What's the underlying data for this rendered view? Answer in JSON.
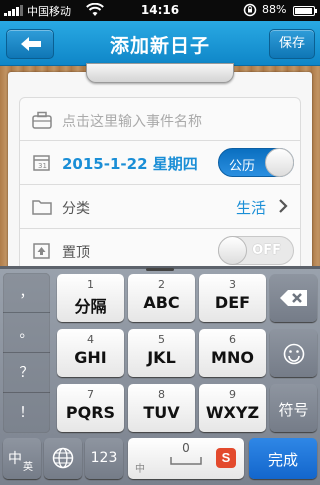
{
  "status_bar": {
    "carrier": "中国移动",
    "time": "14:16",
    "battery_pct": "88%"
  },
  "nav": {
    "title": "添加新日子",
    "save_label": "保存"
  },
  "form": {
    "event_placeholder": "点击这里输入事件名称",
    "date": "2015-1-22 星期四",
    "calendar_toggle": "公历",
    "category_label": "分类",
    "category_value": "生活",
    "pin_label": "置顶",
    "pin_toggle": "OFF"
  },
  "keyboard": {
    "side_keys": [
      "，",
      "。",
      "？",
      "！"
    ],
    "rows": [
      [
        {
          "num": "1",
          "label": "分隔"
        },
        {
          "num": "2",
          "label": "ABC"
        },
        {
          "num": "3",
          "label": "DEF"
        }
      ],
      [
        {
          "num": "4",
          "label": "GHI"
        },
        {
          "num": "5",
          "label": "JKL"
        },
        {
          "num": "6",
          "label": "MNO"
        }
      ],
      [
        {
          "num": "7",
          "label": "PQRS"
        },
        {
          "num": "8",
          "label": "TUV"
        },
        {
          "num": "9",
          "label": "WXYZ"
        }
      ]
    ],
    "symbol_key": "符号",
    "lang_key": "中",
    "lang_key_sub": "英",
    "num_key": "123",
    "space_num": "0",
    "space_sub": "中",
    "done_key": "完成"
  }
}
